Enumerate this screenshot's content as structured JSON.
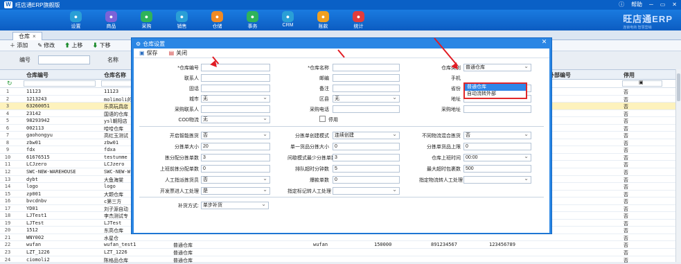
{
  "app": {
    "title": "旺店通ERP旗舰版",
    "help": "帮助",
    "brand": "旺店通ERP",
    "brand_sub": "连锁电商 智慧营销"
  },
  "toolbar": [
    {
      "label": "设置",
      "color": "#2a9fd6"
    },
    {
      "label": "商品",
      "color": "#7b63d8"
    },
    {
      "label": "采购",
      "color": "#2fb35a"
    },
    {
      "label": "销售",
      "color": "#2a9fd6"
    },
    {
      "label": "仓储",
      "color": "#f08a24"
    },
    {
      "label": "事务",
      "color": "#2fb35a"
    },
    {
      "label": "CRM",
      "color": "#2a9fd6"
    },
    {
      "label": "账款",
      "color": "#f0a020"
    },
    {
      "label": "统计",
      "color": "#e23c3c"
    }
  ],
  "tab": {
    "label": "仓库",
    "close": "×"
  },
  "subbar": {
    "add": "添加",
    "edit": "修改",
    "up": "上移",
    "down": "下移"
  },
  "filter": {
    "code_label": "编号",
    "name_label": "名称"
  },
  "grid": {
    "headers": {
      "code": "仓库编号",
      "name": "仓库名称",
      "ext": "外部编号",
      "disabled": "停用"
    },
    "rows": [
      {
        "n": "1",
        "code": "11123",
        "name": "11123",
        "dis": "否"
      },
      {
        "n": "2",
        "code": "1213243",
        "name": "molimoli的",
        "dis": "否"
      },
      {
        "n": "3",
        "code": "63260051",
        "name": "乐高玩具店",
        "dis": "否"
      },
      {
        "n": "4",
        "code": "23142",
        "name": "国语的仓库",
        "dis": "否"
      },
      {
        "n": "5",
        "code": "98293942",
        "name": "ysl朝阳店",
        "dis": "否"
      },
      {
        "n": "6",
        "code": "002113",
        "name": "哈哈仓库",
        "dis": "否"
      },
      {
        "n": "7",
        "code": "gaohongyu",
        "name": "高红玉测试",
        "dis": "否"
      },
      {
        "n": "8",
        "code": "zbw01",
        "name": "zbw01",
        "dis": "否"
      },
      {
        "n": "9",
        "code": "fdx",
        "name": "fdxa",
        "dis": "否"
      },
      {
        "n": "10",
        "code": "61676515",
        "name": "testunme",
        "dis": "否"
      },
      {
        "n": "11",
        "code": "LCJzero",
        "name": "LCJzero",
        "dis": "否"
      },
      {
        "n": "12",
        "code": "SWC-NEW-WAREHOUSE",
        "name": "SWC-NEW-W",
        "dis": "否"
      },
      {
        "n": "13",
        "code": "dybt",
        "name": "大鱼海棠",
        "dis": "否"
      },
      {
        "n": "14",
        "code": "logo",
        "name": "logo",
        "dis": "否"
      },
      {
        "n": "15",
        "code": "zp001",
        "name": "大颗仓库",
        "dis": "否"
      },
      {
        "n": "16",
        "code": "bvcdnbv",
        "name": "c第三方",
        "dis": "否"
      },
      {
        "n": "17",
        "code": "YD01",
        "name": "刘子源自动",
        "dis": "否"
      },
      {
        "n": "18",
        "code": "LJTest1",
        "name": "李杰测试专",
        "dis": "否"
      },
      {
        "n": "19",
        "code": "LJTest",
        "name": "LJTest",
        "dis": "否"
      },
      {
        "n": "20",
        "code": "1512",
        "name": "东高仓库",
        "dis": "否"
      },
      {
        "n": "21",
        "code": "WNY002",
        "name": "水星仓",
        "dis": "否"
      },
      {
        "n": "22",
        "code": "wufan",
        "name": "wufan_test1",
        "type": "普通仓库",
        "c1": "wufan",
        "c2": "150000",
        "c3": "891234567",
        "c4": "123456789",
        "dis": "否"
      },
      {
        "n": "23",
        "code": "LZT_1226",
        "name": "LZT_1226",
        "type": "普通仓库",
        "dis": "否"
      },
      {
        "n": "24",
        "code": "ciomoli2",
        "name": "陈格品仓库",
        "type": "普通仓库",
        "dis": "否"
      }
    ]
  },
  "dialog": {
    "title": "仓库设置",
    "save": "保存",
    "close": "关闭",
    "fields": {
      "code": "*仓库编号",
      "name": "*仓库名称",
      "type": "仓库类别",
      "type_value": "普通仓库",
      "contact": "联系人",
      "email": "邮编",
      "mobile": "手机",
      "phone": "固话",
      "remark": "备注",
      "province": "省份",
      "city": "城市",
      "city_value": "无",
      "district": "区县",
      "district_value": "无",
      "address": "地址",
      "buyer": "采购联系人",
      "buy_phone": "采购电话",
      "buy_addr": "采购地址",
      "cod": "COD物流",
      "cod_value": "无",
      "disabled": "停用"
    },
    "pick": {
      "smart": "开启智能拣货",
      "smart_v": "否",
      "mode": "分拣单创建模式",
      "mode_v": "连续创建",
      "mixed": "不同物流混合拣货",
      "mixed_v": "否",
      "size": "分拣单大小",
      "size_v": "20",
      "single": "单一货品分拣大小",
      "single_v": "0",
      "limit": "分拣单货品上限",
      "limit_v": "0",
      "batch": "拣分配分拣单数",
      "batch_v": "3",
      "wave": "间歇模式最少分拣单数",
      "wave_v": "3",
      "work": "仓库上班时间",
      "work_v": "00:00",
      "before": "上班前拣分配单数",
      "before_v": "0",
      "queue": "排队超时分钟数",
      "queue_v": "5",
      "maxout": "最大超时包裹数",
      "maxout_v": "500",
      "manual": "人工指派拣货员",
      "manual_v": "否",
      "burst": "爆款单数",
      "burst_v": "0",
      "assign": "指定物流转人工处理",
      "invoice": "开发票进人工处理",
      "invoice_v": "是",
      "mark": "指定标记转人工处理",
      "replenish": "补货方式:",
      "replenish_v": "单步补货"
    },
    "dropdown": {
      "opt1": "普通仓库",
      "opt2": "自动流转外部"
    }
  }
}
